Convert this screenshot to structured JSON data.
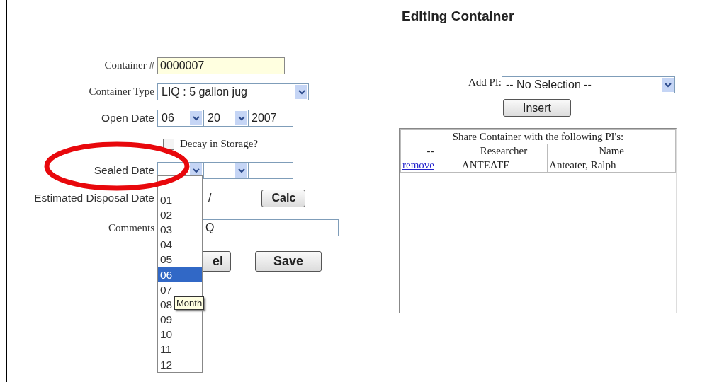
{
  "title": "Editing Container",
  "form_rows": [
    {
      "kind": "key",
      "label": "Container #",
      "value": "0000007"
    },
    {
      "kind": "select",
      "label": "Container Type",
      "value": "LIQ : 5 gallon jug"
    },
    {
      "kind": "date",
      "label": "Open Date",
      "month": "06",
      "day": "20",
      "year": "2007"
    },
    {
      "kind": "checkbox",
      "label": "Decay in Storage?",
      "checked": false
    },
    {
      "kind": "date",
      "label": "Sealed Date"
    },
    {
      "kind": "calc",
      "label": "Estimated Disposal Date",
      "separator": "/",
      "button": "Calc"
    },
    {
      "kind": "comment",
      "label": "Comments",
      "value": "Q"
    }
  ],
  "buttons": [
    "el",
    "Save"
  ],
  "month_dropdown": {
    "options": [
      {
        "label": "01",
        "selected": false
      },
      {
        "label": "02",
        "selected": false
      },
      {
        "label": "03",
        "selected": false
      },
      {
        "label": "04",
        "selected": false
      },
      {
        "label": "05",
        "selected": false
      },
      {
        "label": "06",
        "selected": true
      },
      {
        "label": "07",
        "selected": false
      },
      {
        "label": "08",
        "selected": false
      },
      {
        "label": "09",
        "selected": false
      },
      {
        "label": "10",
        "selected": false
      },
      {
        "label": "11",
        "selected": false
      },
      {
        "label": "12",
        "selected": false
      }
    ],
    "tooltip": "Month"
  },
  "add_pi": {
    "label": "Add PI:",
    "value": "-- No Selection --",
    "button": "Insert"
  },
  "share_table": {
    "caption": "Share Container with the following PI's:",
    "columns": [
      "--",
      "Researcher",
      "Name"
    ],
    "rows": [
      {
        "action": "remove",
        "researcher": "ANTEATE",
        "name": "Anteater, Ralph"
      }
    ]
  }
}
